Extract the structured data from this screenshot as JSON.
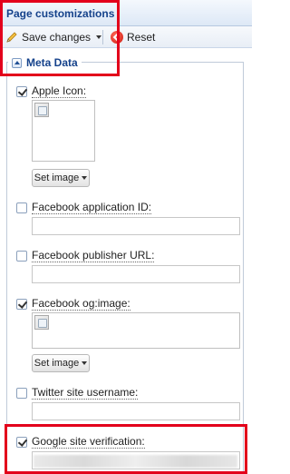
{
  "header": {
    "title": "Page customizations"
  },
  "toolbar": {
    "save_label": "Save changes",
    "reset_label": "Reset"
  },
  "section": {
    "legend": "Meta Data"
  },
  "fields": [
    {
      "label": "Apple Icon:",
      "checked": true,
      "type": "image",
      "button": "Set image"
    },
    {
      "label": "Facebook application ID:",
      "checked": false,
      "type": "text",
      "value": ""
    },
    {
      "label": "Facebook publisher URL:",
      "checked": false,
      "type": "text",
      "value": ""
    },
    {
      "label": "Facebook og:image:",
      "checked": true,
      "type": "image",
      "button": "Set image"
    },
    {
      "label": "Twitter site username:",
      "checked": false,
      "type": "text",
      "value": ""
    },
    {
      "label": "Google site verification:",
      "checked": true,
      "type": "text",
      "value": ""
    }
  ],
  "icons": {
    "save": "pencil-icon",
    "reset": "reset-icon",
    "collapse": "collapse-up-icon"
  },
  "colors": {
    "title": "#15428b",
    "highlight": "#e3001b"
  }
}
